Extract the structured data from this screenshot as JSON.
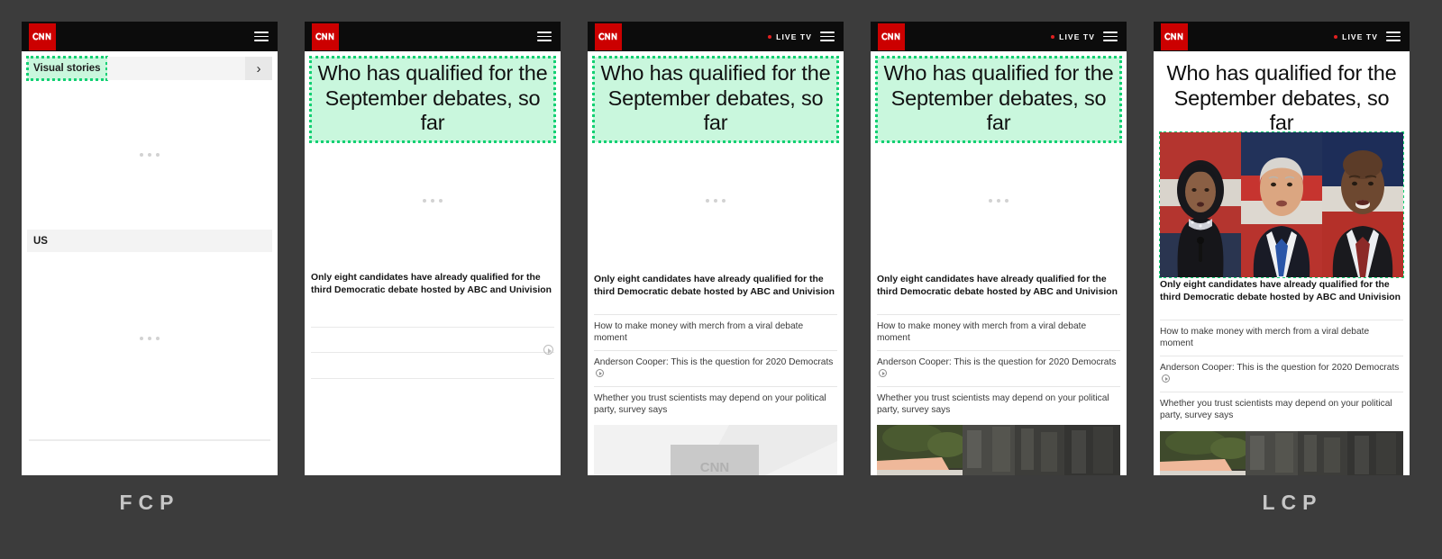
{
  "background_color": "#3c3c3c",
  "highlight_color": "#13d073",
  "highlight_fill": "#c9f7dd",
  "brand_color": "#cc0000",
  "captions": {
    "first": "FCP",
    "last": "LCP"
  },
  "site": {
    "logo_text": "CNN",
    "live_tv_label": "LIVE TV",
    "menu_icon": "hamburger-icon",
    "live_dot_icon": "live-indicator-dot"
  },
  "headline": "Who has qualified for the September debates, so far",
  "blurb": "Only eight candidates have already qualified for the third Democratic debate hosted by ABC and Univision",
  "articles": [
    {
      "text": "How to make money with merch from a viral debate moment",
      "has_video": false
    },
    {
      "text": "Anderson Cooper: This is the question for 2020 Democrats",
      "has_video": true
    },
    {
      "text": "Whether you trust scientists may depend on your political party, survey says",
      "has_video": false
    }
  ],
  "frames": [
    {
      "id": "frame-1",
      "label": "FCP",
      "has_live_tv": false,
      "visual_stories_label": "Visual stories",
      "visual_stories_highlighted": true,
      "section_label": "US",
      "chevron_icon": "chevron-right-icon",
      "headline_visible": false,
      "image_visible": false
    },
    {
      "id": "frame-2",
      "label": "",
      "has_live_tv": false,
      "headline_visible": true,
      "headline_highlighted": true,
      "blurb_visible": true,
      "articles_visible": false,
      "image_visible": false
    },
    {
      "id": "frame-3",
      "label": "",
      "has_live_tv": true,
      "headline_visible": true,
      "headline_highlighted": true,
      "blurb_visible": true,
      "articles_visible": true,
      "image_visible": true,
      "image_state": "placeholder-gray"
    },
    {
      "id": "frame-4",
      "label": "",
      "has_live_tv": true,
      "headline_visible": true,
      "headline_highlighted": true,
      "blurb_visible": true,
      "articles_visible": true,
      "image_visible": true,
      "image_state": "loaded-color"
    },
    {
      "id": "frame-5",
      "label": "LCP",
      "has_live_tv": true,
      "headline_visible": true,
      "headline_highlighted": false,
      "hero_image_highlighted": true,
      "hero_image_alt": "Three 2020 Democratic candidates at debate",
      "blurb_visible": true,
      "articles_visible": true,
      "image_visible": true,
      "image_state": "loaded-color"
    }
  ]
}
